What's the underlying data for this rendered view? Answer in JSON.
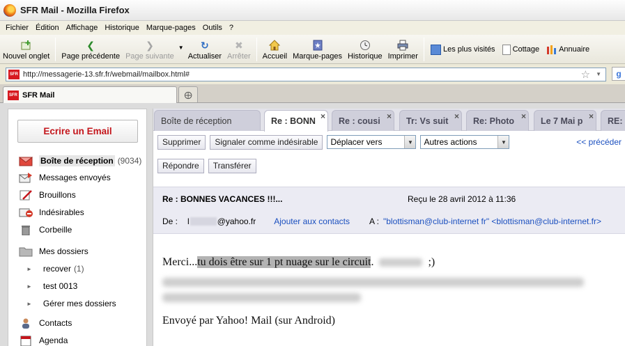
{
  "window": {
    "title": "SFR Mail - Mozilla Firefox"
  },
  "menu": [
    "Fichier",
    "Édition",
    "Affichage",
    "Historique",
    "Marque-pages",
    "Outils",
    "?"
  ],
  "toolbar": {
    "new_tab": "Nouvel onglet",
    "back": "Page précédente",
    "forward": "Page suivante",
    "reload": "Actualiser",
    "stop": "Arrêter",
    "home": "Accueil",
    "bookmarks": "Marque-pages",
    "history": "Historique",
    "print": "Imprimer"
  },
  "bookmarks_bar": [
    "Les plus visités",
    "Cottage",
    "Annuaire"
  ],
  "url": "http://messagerie-13.sfr.fr/webmail/mailbox.html#",
  "browser_tab": {
    "title": "SFR Mail",
    "favicon": "SFR"
  },
  "sidebar": {
    "compose": "Ecrire un Email",
    "folders": [
      {
        "label": "Boîte de réception",
        "count": "(9034)",
        "icon": "inbox-icon"
      },
      {
        "label": "Messages envoyés",
        "icon": "sent-icon"
      },
      {
        "label": "Brouillons",
        "icon": "drafts-icon"
      },
      {
        "label": "Indésirables",
        "icon": "spam-icon"
      },
      {
        "label": "Corbeille",
        "icon": "trash-icon"
      },
      {
        "label": "Mes dossiers",
        "icon": "folder-icon"
      }
    ],
    "subfolders": [
      {
        "label": "recover",
        "count": "(1)"
      },
      {
        "label": "test 0013"
      },
      {
        "label": "Gérer mes dossiers"
      }
    ],
    "bottom": [
      {
        "label": "Contacts",
        "icon": "contacts-icon"
      },
      {
        "label": "Agenda",
        "icon": "calendar-icon"
      }
    ]
  },
  "mail_tabs": [
    "Boîte de réception",
    "Re : BONN",
    "Re : cousi",
    "Tr: Vs suit",
    "Re: Photo",
    "Le 7 Mai p",
    "RE:"
  ],
  "actions": {
    "delete": "Supprimer",
    "report_spam": "Signaler comme indésirable",
    "move_to": "Déplacer vers",
    "other_actions": "Autres actions",
    "previous": "<< précéder",
    "reply": "Répondre",
    "forward": "Transférer"
  },
  "message": {
    "subject": "Re : BONNES VACANCES !!!...",
    "received": "Reçu le 28 avril 2012 à 11:36",
    "from_label": "De :",
    "from_prefix": "l",
    "from_domain": "@yahoo.fr",
    "add_contact": "Ajouter aux contacts",
    "to_label": "A :",
    "to_value": "\"blottisman@club-internet fr\" <blottisman@club-internet.fr>",
    "body_start": "Merci...",
    "body_highlight": "tu dois être sur 1 pt nuage sur le circuit",
    "body_after": ".",
    "body_smiley": ";)",
    "signature": "Envoyé par Yahoo! Mail (sur Android)"
  },
  "colors": {
    "accent_red": "#c4161c",
    "link_blue": "#1a4fbf",
    "sfr_red": "#d71920"
  }
}
